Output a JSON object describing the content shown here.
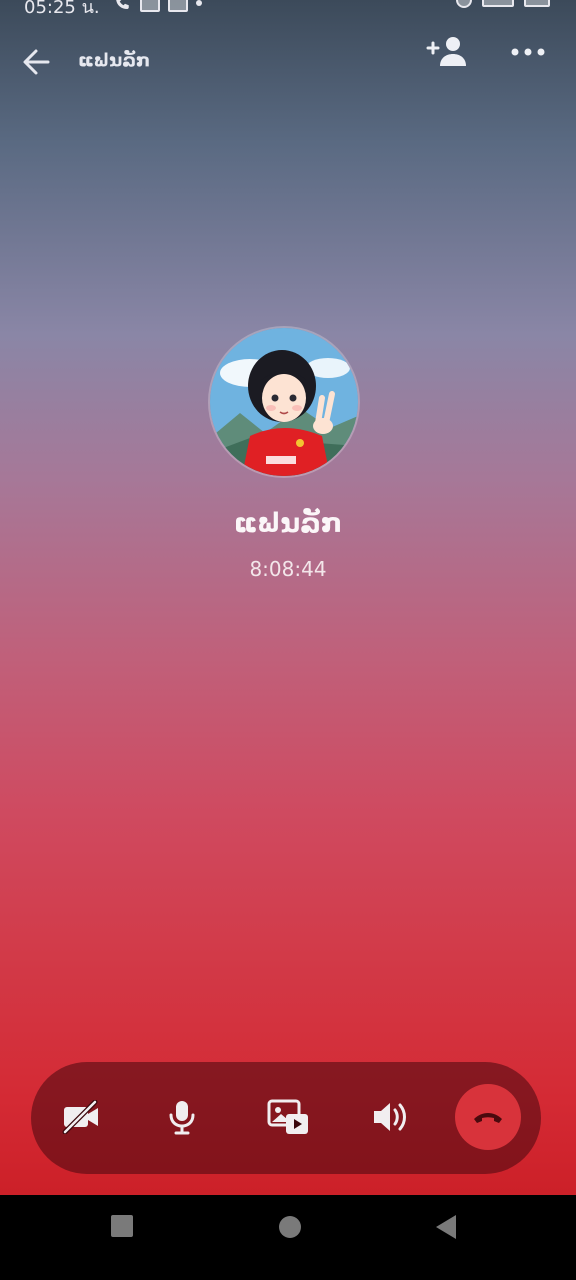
{
  "status_bar": {
    "time": "05:25 น."
  },
  "header": {
    "title": "ແຟນລັກ"
  },
  "call": {
    "contact_name": "ແຟນລັກ",
    "duration": "8:08:44"
  },
  "icons": {
    "back": "arrow-left-icon",
    "add_person": "add-person-icon",
    "more": "more-horizontal-icon",
    "camera_off": "video-off-icon",
    "mic": "microphone-icon",
    "share": "screen-share-icon",
    "speaker": "speaker-icon",
    "end_call": "phone-hangup-icon"
  },
  "colors": {
    "end_call": "#d8333b",
    "accent": "#cc2028"
  }
}
